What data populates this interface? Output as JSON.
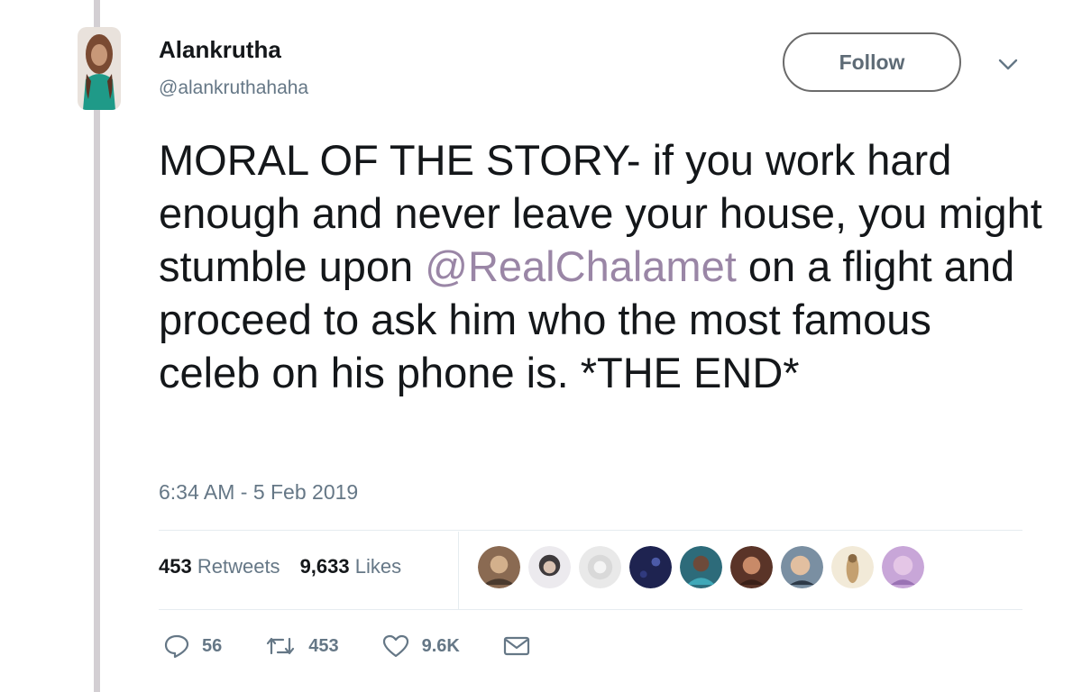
{
  "author": {
    "name": "Alankrutha",
    "handle": "@alankruthahaha"
  },
  "follow_label": "Follow",
  "tweet": {
    "text_before": "MORAL OF THE STORY- if you work hard enough and never leave your house, you might stumble upon ",
    "mention": "@RealChalamet",
    "text_after": " on a flight and proceed to ask him who the most famous celeb on his phone is. *THE END*",
    "timestamp": "6:34 AM - 5 Feb 2019"
  },
  "stats": {
    "retweets_count": "453",
    "retweets_label": "Retweets",
    "likes_count": "9,633",
    "likes_label": "Likes"
  },
  "actions": {
    "reply_count": "56",
    "retweet_count": "453",
    "like_count": "9.6K"
  },
  "colors": {
    "mention": "#9a86a6",
    "secondary_text": "#657786",
    "thread_line": "#d3cfd3"
  },
  "icons": [
    "chevron-down-icon",
    "reply-icon",
    "retweet-icon",
    "heart-icon",
    "mail-icon"
  ]
}
